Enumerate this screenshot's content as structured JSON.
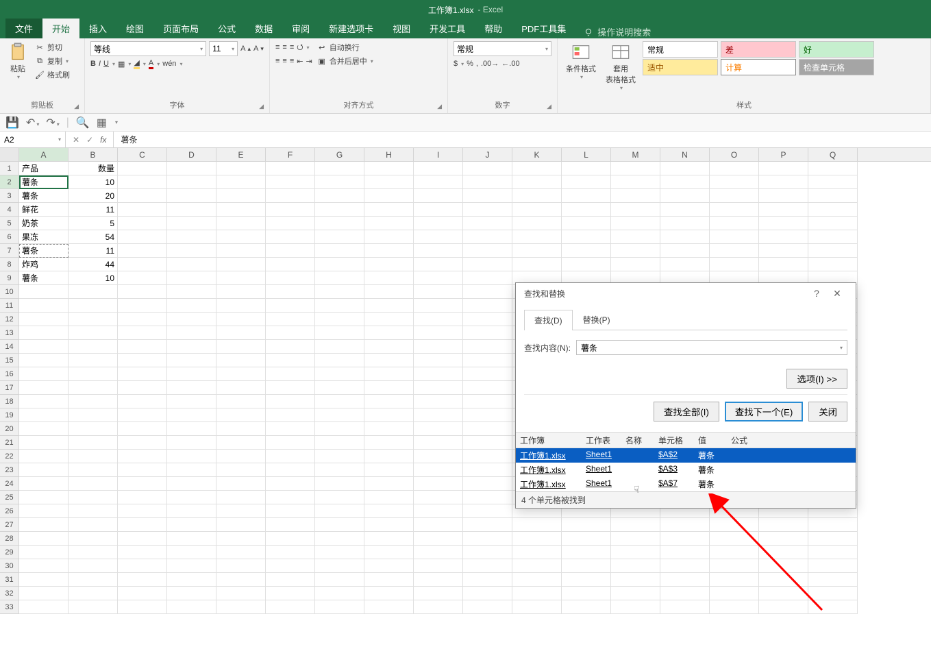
{
  "app": {
    "title_doc": "工作簿1.xlsx",
    "title_app": "Excel"
  },
  "tabs": {
    "file": "文件",
    "home": "开始",
    "insert": "插入",
    "draw": "绘图",
    "layout": "页面布局",
    "formulas": "公式",
    "data": "数据",
    "review": "审阅",
    "newtab": "新建选项卡",
    "view": "视图",
    "dev": "开发工具",
    "help": "帮助",
    "pdf": "PDF工具集",
    "tell_me": "操作说明搜索"
  },
  "ribbon": {
    "clipboard": {
      "paste": "粘贴",
      "cut": "剪切",
      "copy": "复制",
      "painter": "格式刷",
      "label": "剪贴板"
    },
    "font": {
      "name": "等线",
      "size": "11",
      "label": "字体"
    },
    "align": {
      "wrap": "自动换行",
      "merge": "合并后居中",
      "label": "对齐方式"
    },
    "number": {
      "format": "常规",
      "label": "数字"
    },
    "styles": {
      "cond": "条件格式",
      "table": "套用\n表格格式",
      "s1": "常规",
      "s2": "差",
      "s3": "好",
      "s4": "适中",
      "s5": "计算",
      "s6": "检查单元格",
      "label": "样式"
    }
  },
  "namebox": "A2",
  "formula": "薯条",
  "columns": [
    "A",
    "B",
    "C",
    "D",
    "E",
    "F",
    "G",
    "H",
    "I",
    "J",
    "K",
    "L",
    "M",
    "N",
    "O",
    "P",
    "Q"
  ],
  "sheet": {
    "headers": {
      "A": "产品",
      "B": "数量"
    },
    "rows": [
      {
        "A": "薯条",
        "B": 10
      },
      {
        "A": "薯条",
        "B": 20
      },
      {
        "A": "鲜花",
        "B": 11
      },
      {
        "A": "奶茶",
        "B": 5
      },
      {
        "A": "果冻",
        "B": 54
      },
      {
        "A": "薯条",
        "B": 11
      },
      {
        "A": "炸鸡",
        "B": 44
      },
      {
        "A": "薯条",
        "B": 10
      }
    ]
  },
  "dialog": {
    "title": "查找和替换",
    "tab_find": "查找(D)",
    "tab_replace": "替换(P)",
    "field_label": "查找内容(N):",
    "field_value": "薯条",
    "options": "选项(I) >>",
    "find_all": "查找全部(I)",
    "find_next": "查找下一个(E)",
    "close": "关闭",
    "cols": {
      "wb": "工作簿",
      "ws": "工作表",
      "nm": "名称",
      "cl": "单元格",
      "vl": "值",
      "fx": "公式"
    },
    "results": [
      {
        "wb": "工作簿1.xlsx",
        "ws": "Sheet1",
        "cl": "$A$2",
        "vl": "薯条"
      },
      {
        "wb": "工作簿1.xlsx",
        "ws": "Sheet1",
        "cl": "$A$3",
        "vl": "薯条"
      },
      {
        "wb": "工作簿1.xlsx",
        "ws": "Sheet1",
        "cl": "$A$7",
        "vl": "薯条"
      }
    ],
    "status": "4 个单元格被找到"
  }
}
